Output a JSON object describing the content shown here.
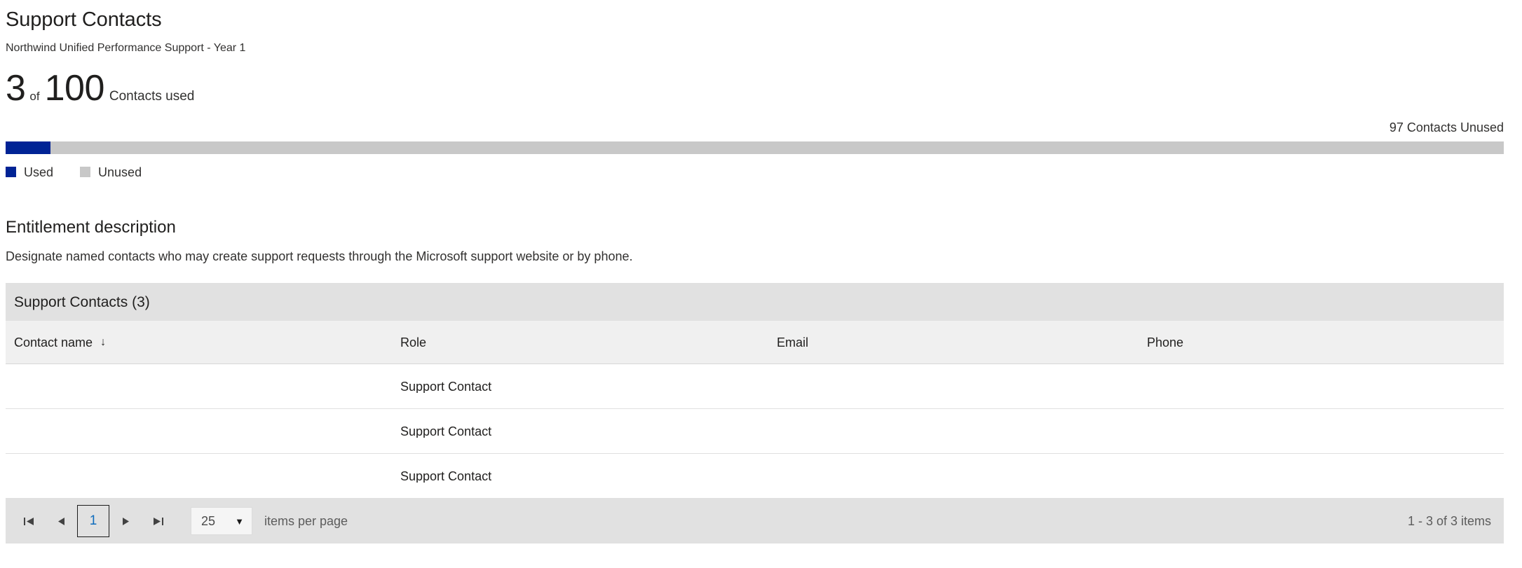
{
  "header": {
    "title": "Support Contacts",
    "subtitle": "Northwind Unified Performance Support - Year 1"
  },
  "usage": {
    "used": "3",
    "of_label": "of",
    "total": "100",
    "caption": "Contacts used",
    "unused_label": "97 Contacts Unused",
    "used_percent": 3,
    "used_color": "#002395",
    "unused_color": "#c8c8c8",
    "legend": [
      {
        "label": "Used",
        "color": "#002395",
        "icon": "used-swatch"
      },
      {
        "label": "Unused",
        "color": "#c8c8c8",
        "icon": "unused-swatch"
      }
    ]
  },
  "entitlement": {
    "title": "Entitlement description",
    "body": "Designate named contacts who may create support requests through the Microsoft support website or by phone."
  },
  "grid": {
    "title": "Support Contacts (3)",
    "columns": [
      {
        "label": "Contact name",
        "sorted": true,
        "sort_icon": "↓"
      },
      {
        "label": "Role",
        "sorted": false,
        "sort_icon": ""
      },
      {
        "label": "Email",
        "sorted": false,
        "sort_icon": ""
      },
      {
        "label": "Phone",
        "sorted": false,
        "sort_icon": ""
      }
    ],
    "rows": [
      {
        "contact_name": "",
        "role": "Support Contact",
        "email": "",
        "phone": ""
      },
      {
        "contact_name": "",
        "role": "Support Contact",
        "email": "",
        "phone": ""
      },
      {
        "contact_name": "",
        "role": "Support Contact",
        "email": "",
        "phone": ""
      }
    ]
  },
  "pager": {
    "first_icon": "⏮",
    "prev_icon": "◀",
    "current_page": "1",
    "next_icon": "▶",
    "last_icon": "⏭",
    "page_size": "25",
    "caret_icon": "▼",
    "items_per_page_label": "items per page",
    "summary": "1 - 3 of 3 items"
  }
}
